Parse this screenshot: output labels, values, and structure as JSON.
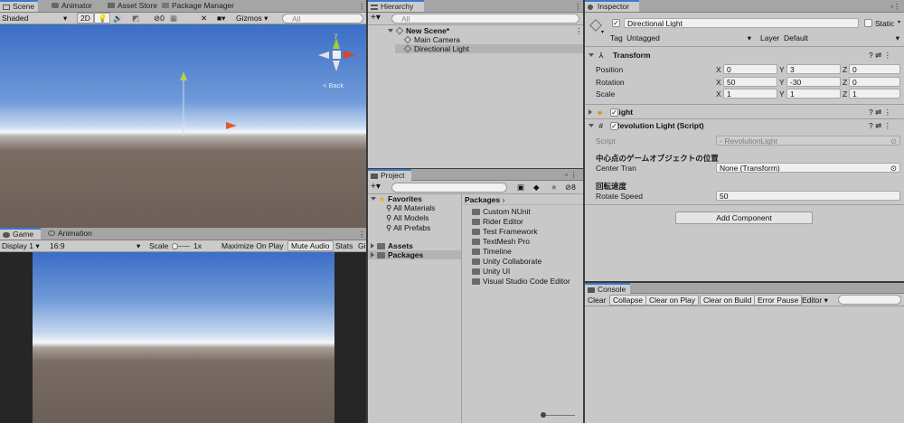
{
  "scene": {
    "tabs": [
      "Scene",
      "Animator",
      "Asset Store",
      "Package Manager"
    ],
    "shading": "Shaded",
    "mode2d": "2D",
    "fx_count": "0",
    "gizmos": "Gizmos",
    "search_placeholder": "All",
    "back_label": "< Back"
  },
  "game": {
    "tabs": [
      "Game",
      "Animation"
    ],
    "display": "Display 1",
    "aspect": "16:9",
    "scale_label": "Scale",
    "scale_value": "1x",
    "maximize": "Maximize On Play",
    "mute": "Mute Audio",
    "stats": "Stats",
    "gizmos_cut": "Gi"
  },
  "hierarchy": {
    "tab": "Hierarchy",
    "search_placeholder": "All",
    "scene": "New Scene*",
    "items": [
      "Main Camera",
      "Directional Light"
    ]
  },
  "project": {
    "tab": "Project",
    "count": "8",
    "favorites": "Favorites",
    "fav_items": [
      "All Materials",
      "All Models",
      "All Prefabs"
    ],
    "roots": [
      "Assets",
      "Packages"
    ],
    "breadcrumb": "Packages",
    "packages": [
      "Custom NUnit",
      "Rider Editor",
      "Test Framework",
      "TextMesh Pro",
      "Timeline",
      "Unity Collaborate",
      "Unity UI",
      "Visual Studio Code Editor"
    ]
  },
  "inspector": {
    "tab": "Inspector",
    "object_name": "Directional Light",
    "static_label": "Static",
    "tag_label": "Tag",
    "tag_value": "Untagged",
    "layer_label": "Layer",
    "layer_value": "Default",
    "transform": {
      "title": "Transform",
      "rows": [
        {
          "label": "Position",
          "x": "0",
          "y": "3",
          "z": "0"
        },
        {
          "label": "Rotation",
          "x": "50",
          "y": "-30",
          "z": "0"
        },
        {
          "label": "Scale",
          "x": "1",
          "y": "1",
          "z": "1"
        }
      ]
    },
    "light": {
      "title": "Light"
    },
    "script": {
      "title": "Revolution Light (Script)",
      "script_label": "Script",
      "script_value": "RevolutionLight",
      "header1": "中心点のゲームオブジェクトの位置",
      "center_label": "Center Tran",
      "center_value": "None (Transform)",
      "header2": "回転速度",
      "speed_label": "Rotate Speed",
      "speed_value": "50"
    },
    "add_component": "Add Component"
  },
  "console": {
    "tab": "Console",
    "buttons": [
      "Clear",
      "Collapse",
      "Clear on Play",
      "Clear on Build",
      "Error Pause",
      "Editor"
    ]
  },
  "colors": {
    "accent": "#3a79d0",
    "sky_top": "#3a6ec7",
    "horizon": "#f2f6fb",
    "ground": "#6c6058",
    "panel": "#c8c8c8"
  }
}
